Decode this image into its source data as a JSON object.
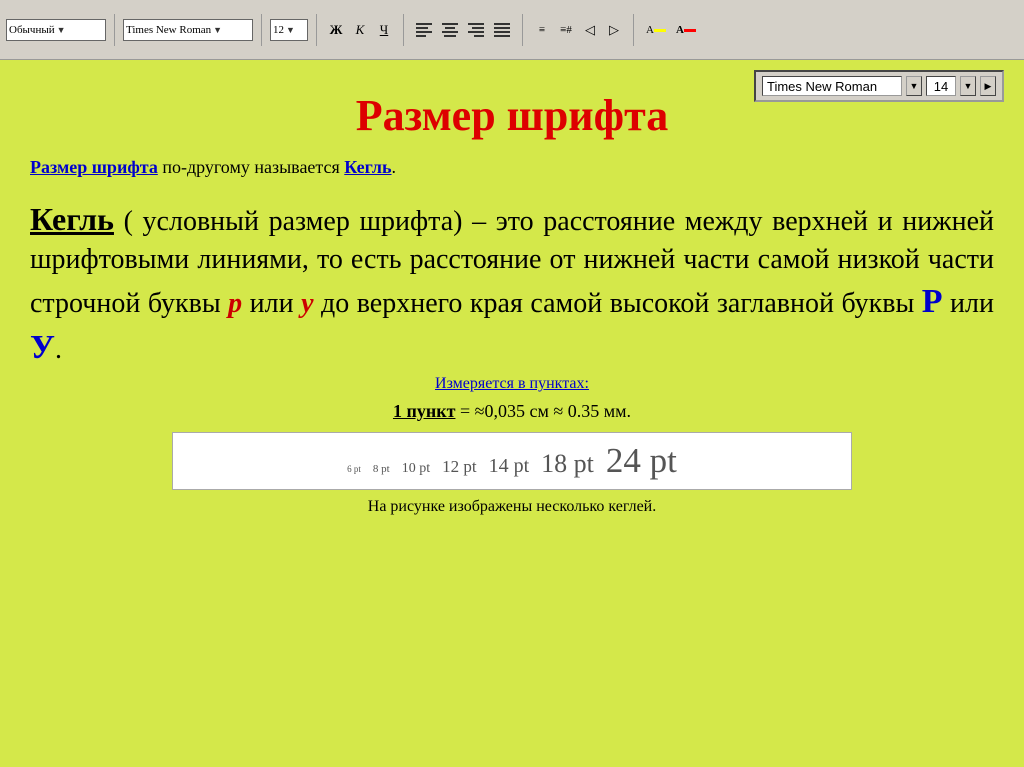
{
  "toolbar": {
    "style_label": "Обычный",
    "font_label": "Times New Roman",
    "size_label": "12",
    "bold_label": "Ж",
    "italic_label": "К",
    "underline_label": "Ч"
  },
  "font_selector": {
    "font_name": "Times New Roman",
    "font_size": "14"
  },
  "page": {
    "title": "Размер шрифта",
    "subtitle_part1": "Размер шрифта",
    "subtitle_part2": " по-другому называется ",
    "subtitle_part3": "Кегль",
    "subtitle_part4": ".",
    "main_para_kegel": "Кегль",
    "main_para_rest": " ( условный размер шрифта) – это расстояние между верхней и нижней шрифтовыми линиями, то есть расстояние от нижней части самой низкой части строчной буквы ",
    "letter_p": "р",
    "main_para_or1": " или ",
    "letter_y": "у",
    "main_para_rest2": " до верхнего края самой высокой заглавной буквы ",
    "letter_P": "Р",
    "main_para_or2": " или ",
    "letter_Y": "У",
    "main_para_end": ".",
    "measures_text": "Измеряется в пунктах:",
    "point_def_label": "1 пункт",
    "point_def_rest": " = ≈0,035 см ≈ 0.35 мм.",
    "font_sizes": [
      {
        "size": "6 pt",
        "fs": "9px"
      },
      {
        "size": "8 pt",
        "fs": "11px"
      },
      {
        "size": "10 pt",
        "fs": "14px"
      },
      {
        "size": "12 pt",
        "fs": "17px"
      },
      {
        "size": "14 pt",
        "fs": "20px"
      },
      {
        "size": "18 pt",
        "fs": "26px"
      },
      {
        "size": "24 pt",
        "fs": "35px"
      }
    ],
    "caption": "На рисунке изображены несколько кеглей."
  }
}
